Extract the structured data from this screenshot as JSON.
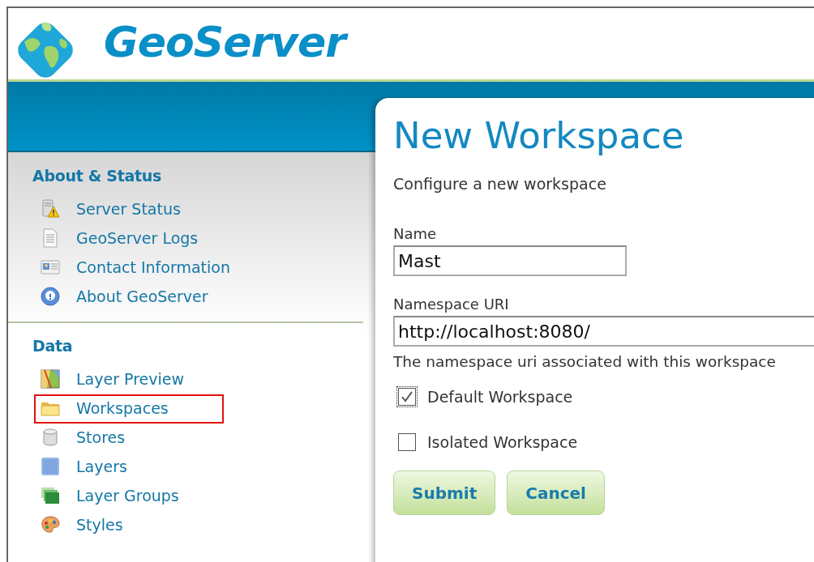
{
  "header": {
    "title": "GeoServer"
  },
  "sidebar": {
    "sections": [
      {
        "title": "About & Status",
        "items": [
          {
            "label": "Server Status",
            "kind": "server",
            "highlighted": false
          },
          {
            "label": "GeoServer Logs",
            "kind": "document",
            "highlighted": false
          },
          {
            "label": "Contact Information",
            "kind": "card",
            "highlighted": false
          },
          {
            "label": "About GeoServer",
            "kind": "help",
            "highlighted": false
          }
        ]
      },
      {
        "title": "Data",
        "items": [
          {
            "label": "Layer Preview",
            "kind": "map",
            "highlighted": false
          },
          {
            "label": "Workspaces",
            "kind": "folder",
            "highlighted": true
          },
          {
            "label": "Stores",
            "kind": "database",
            "highlighted": false
          },
          {
            "label": "Layers",
            "kind": "layer",
            "highlighted": false
          },
          {
            "label": "Layer Groups",
            "kind": "layers",
            "highlighted": false
          },
          {
            "label": "Styles",
            "kind": "palette",
            "highlighted": false
          }
        ]
      }
    ]
  },
  "form": {
    "title": "New Workspace",
    "subtitle": "Configure a new workspace",
    "fields": [
      {
        "label": "Name",
        "value": "Mast",
        "kind": "short"
      },
      {
        "label": "Namespace URI",
        "value": "http://localhost:8080/",
        "kind": "wide",
        "hint": "The namespace uri associated with this workspace"
      }
    ],
    "checkboxes": [
      {
        "label": "Default Workspace",
        "checked": true
      },
      {
        "label": "Isolated Workspace",
        "checked": false
      }
    ],
    "buttons": [
      "Submit",
      "Cancel"
    ]
  }
}
